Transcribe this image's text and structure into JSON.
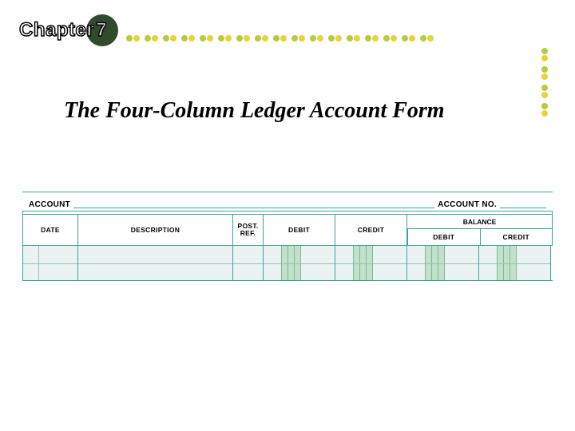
{
  "chapter": {
    "label": "Chapter",
    "number": "7"
  },
  "title": "The Four-Column Ledger Account Form",
  "decor": {
    "horizontal_pairs": 17,
    "vertical_pairs": 4
  },
  "ledger": {
    "account_label": "ACCOUNT",
    "account_no_label": "ACCOUNT NO.",
    "columns": {
      "date": "DATE",
      "description": "DESCRIPTION",
      "post_ref": "POST.\nREF.",
      "debit": "DEBIT",
      "credit": "CREDIT",
      "balance": "BALANCE",
      "balance_debit": "DEBIT",
      "balance_credit": "CREDIT"
    }
  }
}
